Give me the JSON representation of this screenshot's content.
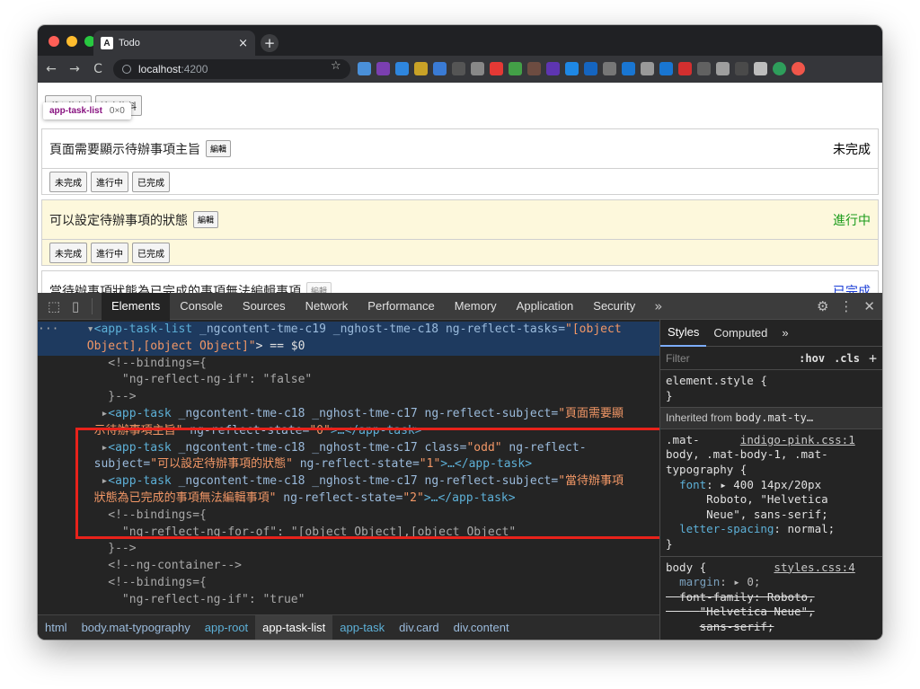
{
  "browser": {
    "tab_title": "Todo",
    "tab_favicon": "A",
    "tab_close": "×",
    "new_tab": "+",
    "nav": {
      "back": "←",
      "forward": "→",
      "reload": "C"
    },
    "url_host": "localhost",
    "url_port": ":4200",
    "star": "☆"
  },
  "page": {
    "top_buttons": [
      "載入資料",
      "清空資料"
    ],
    "tooltip": {
      "name": "app-task-list",
      "size": "0×0"
    },
    "tasks": [
      {
        "subject": "頁面需要顯示待辦事項主旨",
        "edit": "編輯",
        "state_label": "未完成",
        "state_color": "#000000"
      },
      {
        "subject": "可以設定待辦事項的狀態",
        "edit": "編輯",
        "state_label": "進行中",
        "state_color": "#1a9b1a"
      },
      {
        "subject": "當待辦事項狀態為已完成的事項無法編輯事項",
        "edit": "編輯",
        "state_label": "已完成",
        "state_color": "#1a3dd6"
      }
    ],
    "state_buttons": [
      "未完成",
      "進行中",
      "已完成"
    ]
  },
  "devtools": {
    "tabs": [
      "Elements",
      "Console",
      "Sources",
      "Network",
      "Performance",
      "Memory",
      "Application",
      "Security"
    ],
    "more": "»",
    "dom": {
      "l1_dots": "···",
      "l1_tag": "<app-task-list",
      "l1_attrs": " _ngcontent-tme-c19 _nghost-tme-c18 ng-reflect-tasks=",
      "l1_val": "\"[object",
      "l2_val": "Object],[object Object]\"",
      "l2_tail": "> == $0",
      "c1": "<!--bindings={",
      "c2": "  \"ng-reflect-ng-if\": \"false\"",
      "c3": "}-->",
      "t1a_tag": "<app-task",
      "t1a_attr": " _ngcontent-tme-c18 _nghost-tme-c17 ng-reflect-subject=",
      "t1a_val": "\"頁面需要顯",
      "t1b_val": "示待辦事項主旨\"",
      "t1b_attr": " ng-reflect-state=",
      "t1b_v2": "\"0\"",
      "t1b_end": ">…</app-task>",
      "t2a_tag": "<app-task",
      "t2a_attr": " _ngcontent-tme-c18 _nghost-tme-c17 class=",
      "t2a_val": "\"odd\"",
      "t2a_attr2": " ng-reflect-",
      "t2b_attr": "subject=",
      "t2b_val": "\"可以設定待辦事項的狀態\"",
      "t2b_attr2": " ng-reflect-state=",
      "t2b_v2": "\"1\"",
      "t2b_end": ">…</app-task>",
      "t3a_tag": "<app-task",
      "t3a_attr": " _ngcontent-tme-c18 _nghost-tme-c17 ng-reflect-subject=",
      "t3a_val": "\"當待辦事項",
      "t3b_val": "狀態為已完成的事項無法編輯事項\"",
      "t3b_attr": " ng-reflect-state=",
      "t3b_v2": "\"2\"",
      "t3b_end": ">…</app-task>",
      "c4": "<!--bindings={",
      "c5": "  \"ng-reflect-ng-for-of\": \"[object Object],[object Object\"",
      "c6": "}-->",
      "c7": "<!--ng-container-->",
      "c8": "<!--bindings={",
      "c9": "  \"ng-reflect-ng-if\": \"true\""
    },
    "breadcrumbs": [
      "html",
      "body.mat-typography",
      "app-root",
      "app-task-list",
      "app-task",
      "div.card",
      "div.content"
    ],
    "styles": {
      "tabs": [
        "Styles",
        "Computed",
        "»"
      ],
      "filter_placeholder": "Filter",
      "hov": ":hov",
      "cls": ".cls",
      "plus": "+",
      "el_style_1": "element.style {",
      "close_brace": "}",
      "inherited_label": "Inherited from ",
      "inherited_from": "body.mat-ty…",
      "rule1_sel_a": ".mat-",
      "rule1_src": "indigo-pink.css:1",
      "rule1_sel_b": "body, .mat-body-1, .mat-",
      "rule1_sel_c": "typography {",
      "rule1_p1_name": "font",
      "rule1_p1_val": ": ▸ 400 14px/20px",
      "rule1_p1_val2": "Roboto, \"Helvetica",
      "rule1_p1_val3": "Neue\", sans-serif;",
      "rule1_p2_name": "letter-spacing",
      "rule1_p2_val": ": normal;",
      "rule2_sel": "body {",
      "rule2_src": "styles.css:4",
      "rule2_p1_name": "margin",
      "rule2_p1_val": ": ▸ 0;",
      "rule2_p2_name": "font-family",
      "rule2_p2_val": ": Roboto,",
      "rule2_p2_val2": "\"Helvetica Neue\",",
      "rule2_p2_val3": "sans-serif;"
    }
  }
}
